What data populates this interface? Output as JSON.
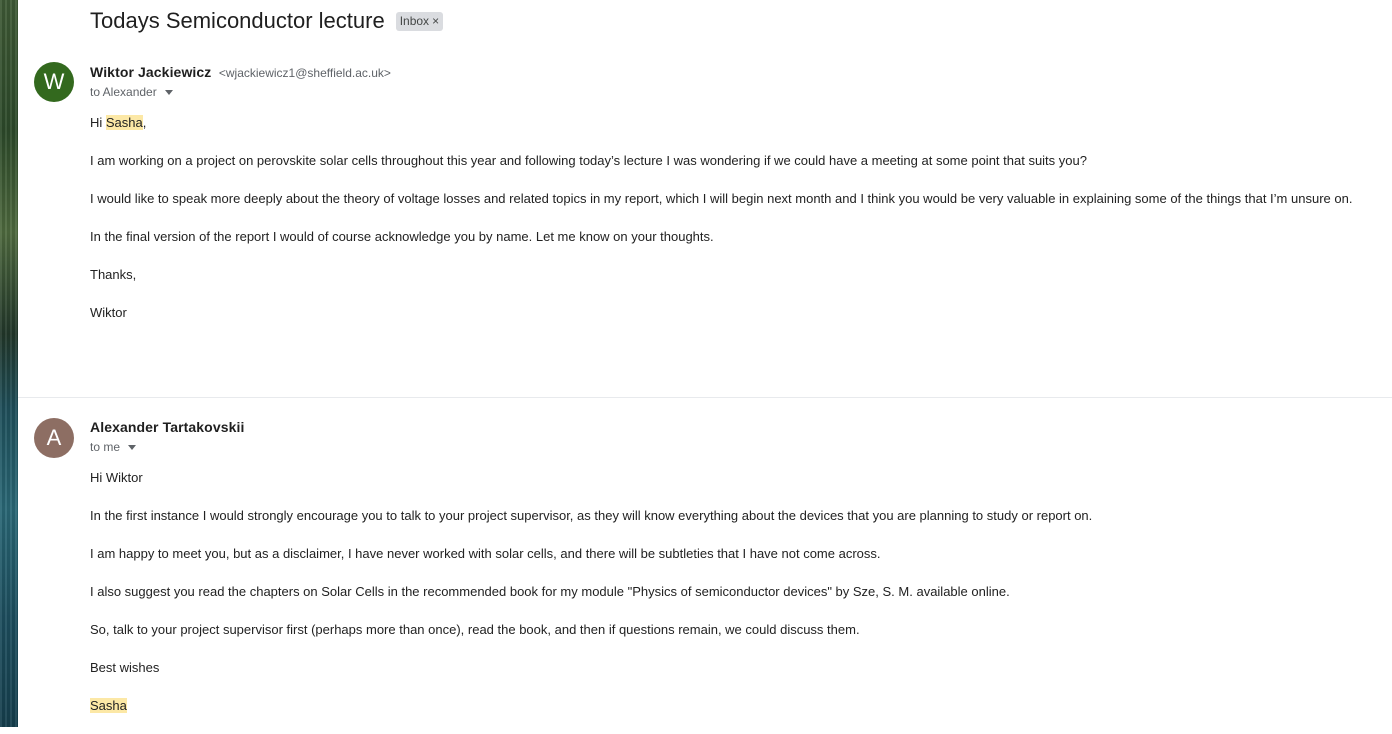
{
  "subject": "Todays Semiconductor lecture",
  "label": {
    "text": "Inbox",
    "close": "×"
  },
  "messages": [
    {
      "avatar_letter": "W",
      "avatar_color": "#33691e",
      "sender_name": "Wiktor Jackiewicz",
      "sender_email": "<wjackiewicz1@sheffield.ac.uk>",
      "to": "to Alexander",
      "greeting_prefix": "Hi ",
      "greeting_name": "Sasha",
      "greeting_suffix": ",",
      "paragraphs": [
        "I am working on a project on perovskite solar cells throughout this year and following today’s lecture I was wondering if we could have a meeting at some point that suits you?",
        "I would like to speak more deeply about the theory of voltage losses and related topics in my report, which I will begin next month and I think you would be very valuable in explaining some of the things that I’m unsure on.",
        "In the final version of the report I would of course acknowledge you by name. Let me know on your thoughts.",
        "Thanks,",
        "Wiktor"
      ]
    },
    {
      "avatar_letter": "A",
      "avatar_color": "#8d6e63",
      "sender_name": "Alexander Tartakovskii",
      "to": "to me",
      "paragraphs": [
        "Hi Wiktor",
        "In the first instance I would strongly encourage you to talk to your project supervisor, as they will know everything about the devices that you are planning to study or report on.",
        "I am happy to meet you, but as a disclaimer, I have never worked with solar cells, and there will be subtleties that I have not come across.",
        "I also suggest you read the chapters on Solar Cells in the recommended book for my module \"Physics of semiconductor devices\" by Sze, S. M. available online.",
        "So, talk to your project supervisor first (perhaps more than once), read the book, and then if questions remain, we could discuss them.",
        "Best wishes"
      ],
      "signature": "Sasha"
    }
  ],
  "colors": {
    "highlight": "#fce8a6",
    "label_chip": "#dadce0"
  }
}
